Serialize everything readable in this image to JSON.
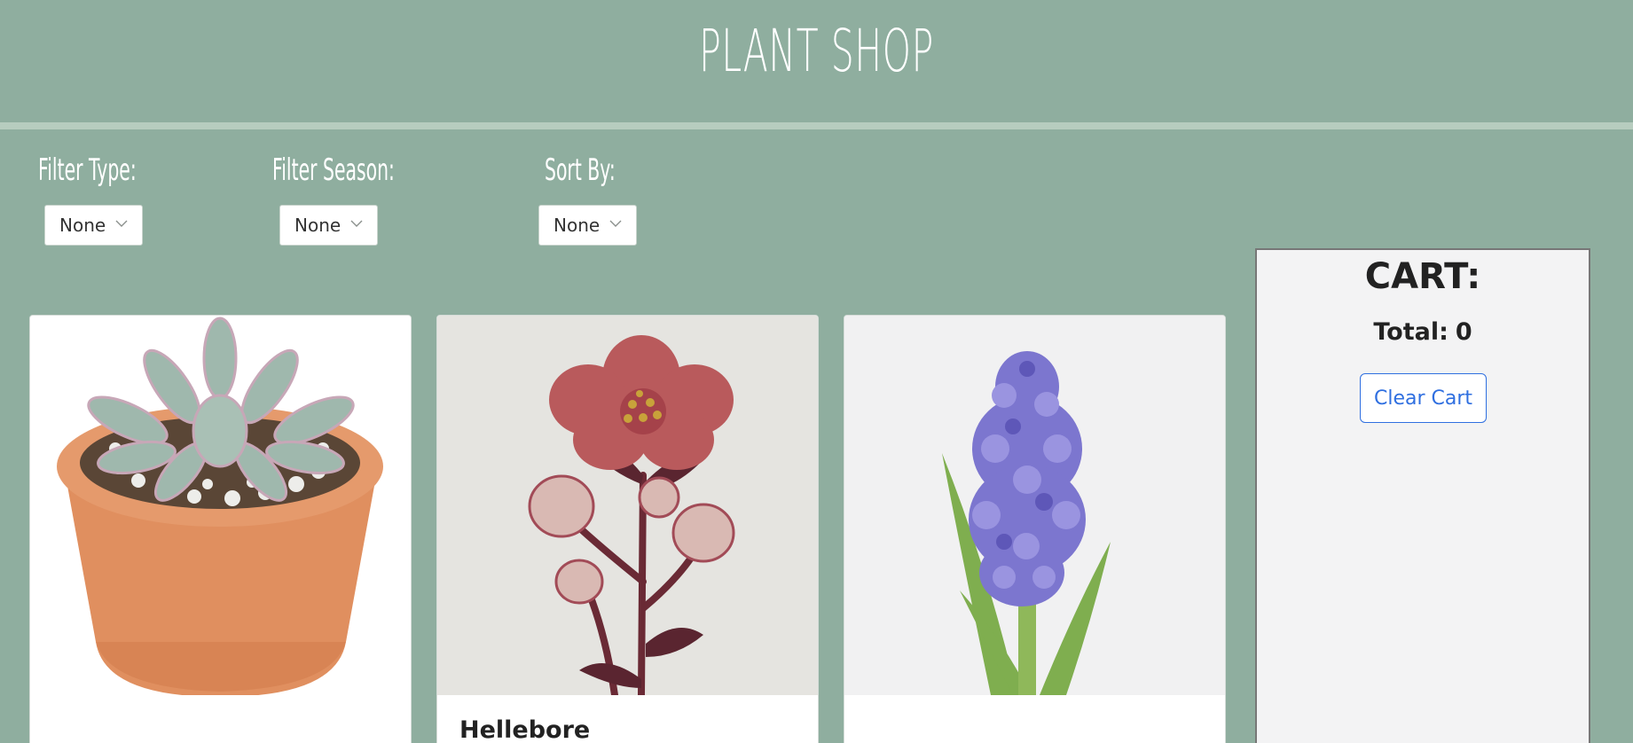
{
  "header": {
    "title": "PLANT SHOP"
  },
  "filters": [
    {
      "label": "Filter Type:",
      "value": "None"
    },
    {
      "label": "Filter Season:",
      "value": "None"
    },
    {
      "label": "Sort By:",
      "value": "None"
    }
  ],
  "products": [
    {
      "name": "",
      "image": "succulent-in-terracotta-pot"
    },
    {
      "name": "Hellebore",
      "image": "hellebore-flower"
    },
    {
      "name": "",
      "image": "purple-hyacinth"
    }
  ],
  "cart": {
    "heading": "CART:",
    "total_label": "Total:",
    "total_value": "0",
    "clear_label": "Clear Cart"
  },
  "colors": {
    "background": "#8fae9f",
    "divider": "#b7cdbf",
    "accent": "#2f6fe0",
    "cart_bg": "#f3f3f4"
  }
}
